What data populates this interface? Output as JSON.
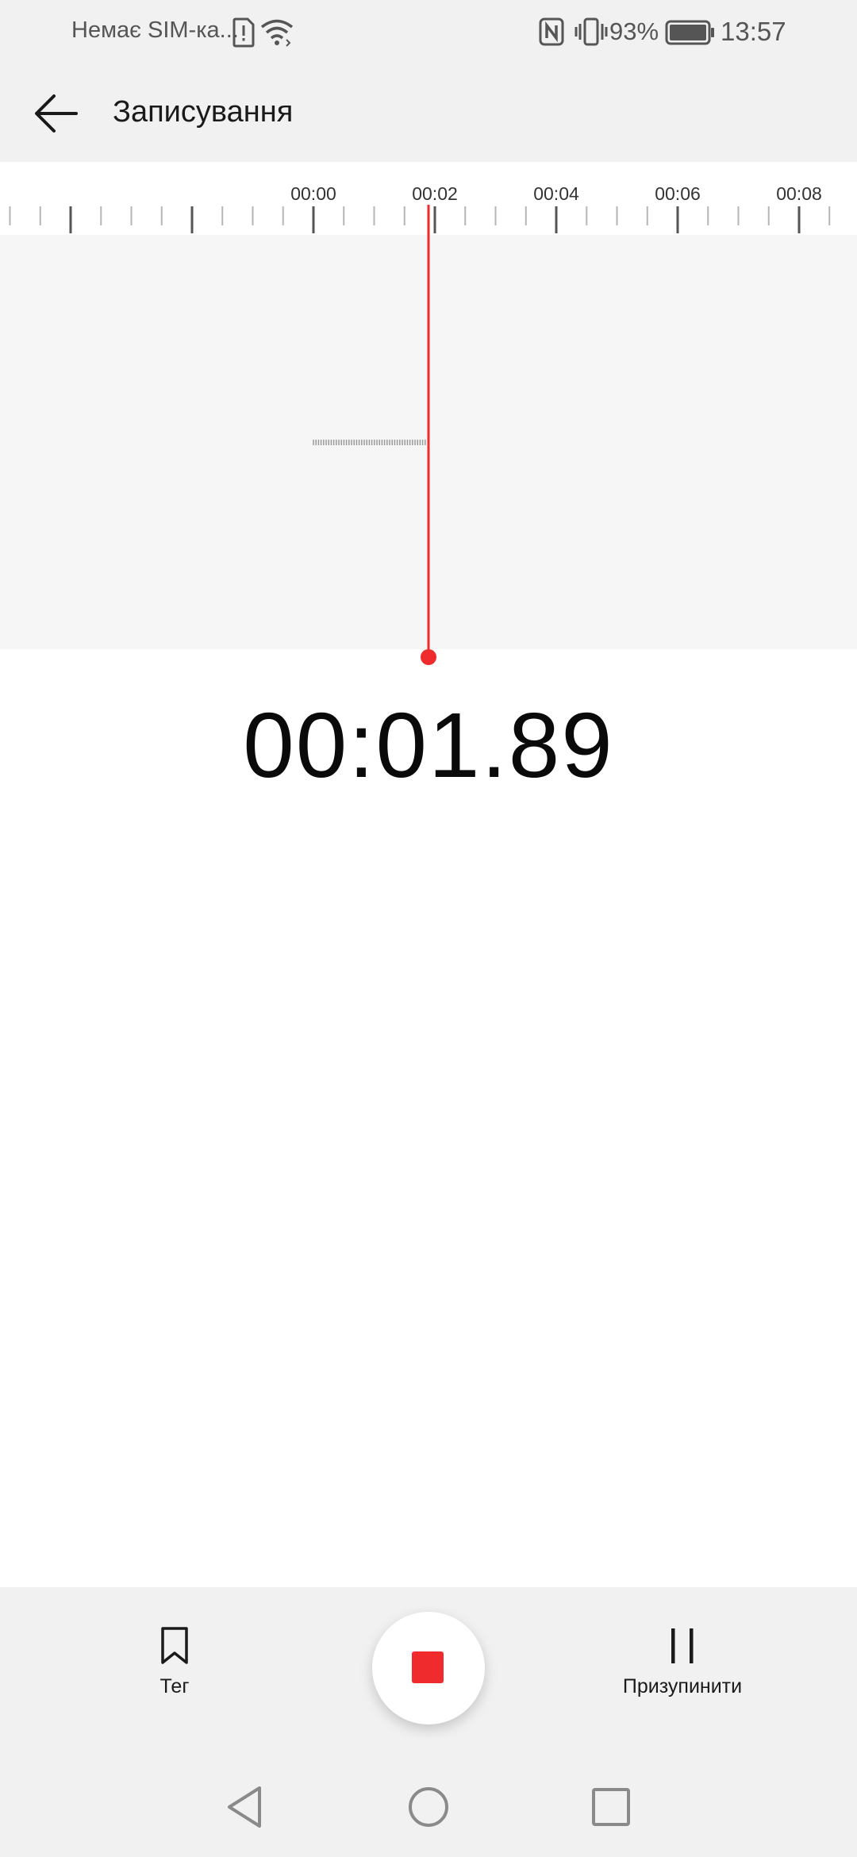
{
  "status_bar": {
    "carrier": "Немає SIM-ка...",
    "battery_percent": "93%",
    "time": "13:57",
    "icons": [
      "sim-alert-icon",
      "wifi-icon",
      "nfc-icon",
      "vibrate-icon",
      "battery-icon"
    ]
  },
  "app_bar": {
    "title": "Записування",
    "back_icon": "arrow-left-icon"
  },
  "timeline": {
    "ticks": [
      "00:00",
      "00:02",
      "00:04",
      "00:06",
      "00:08"
    ]
  },
  "recording": {
    "elapsed": "00:01.89"
  },
  "controls": {
    "tag_label": "Тег",
    "tag_icon": "bookmark-icon",
    "stop_icon": "stop-icon",
    "pause_label": "Призупинити",
    "pause_icon": "pause-icon"
  },
  "nav_bar": {
    "icons": [
      "nav-back-icon",
      "nav-home-icon",
      "nav-recents-icon"
    ]
  },
  "colors": {
    "accent": "#ef2b2d",
    "surface": "#f1f1f1",
    "waveform_bg": "#f6f6f6"
  }
}
